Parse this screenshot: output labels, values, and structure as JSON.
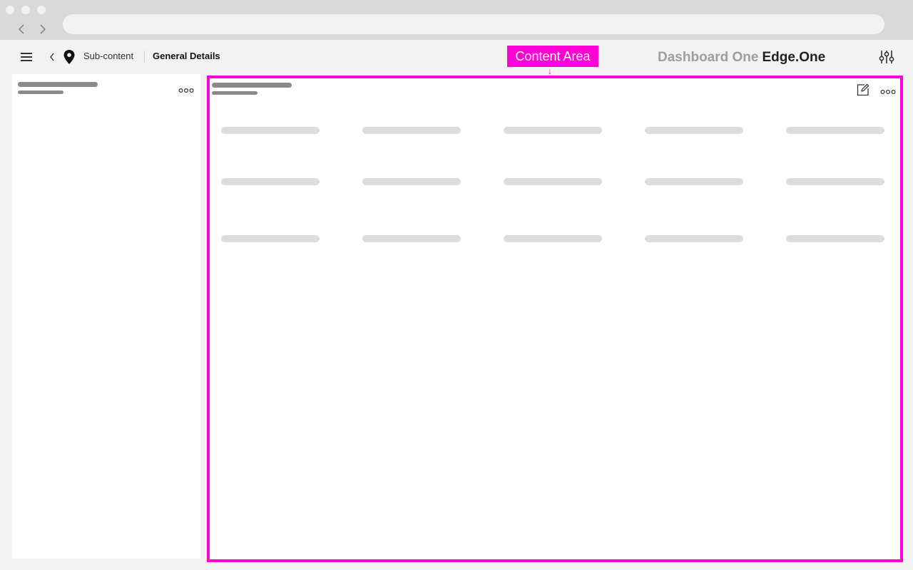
{
  "header": {
    "breadcrumb_parent": "Sub-content",
    "breadcrumb_current": "General Details",
    "brand_primary": "Dashboard One",
    "brand_secondary": "Edge.One"
  },
  "annotation": {
    "label": "Content Area",
    "arrow": "↓"
  },
  "colors": {
    "annotation": "#ff00d7",
    "skeleton": "#dcdcdc",
    "skeleton_dark": "#8a8a8a"
  },
  "content": {
    "grid_rows": 3,
    "grid_cols": 5
  }
}
